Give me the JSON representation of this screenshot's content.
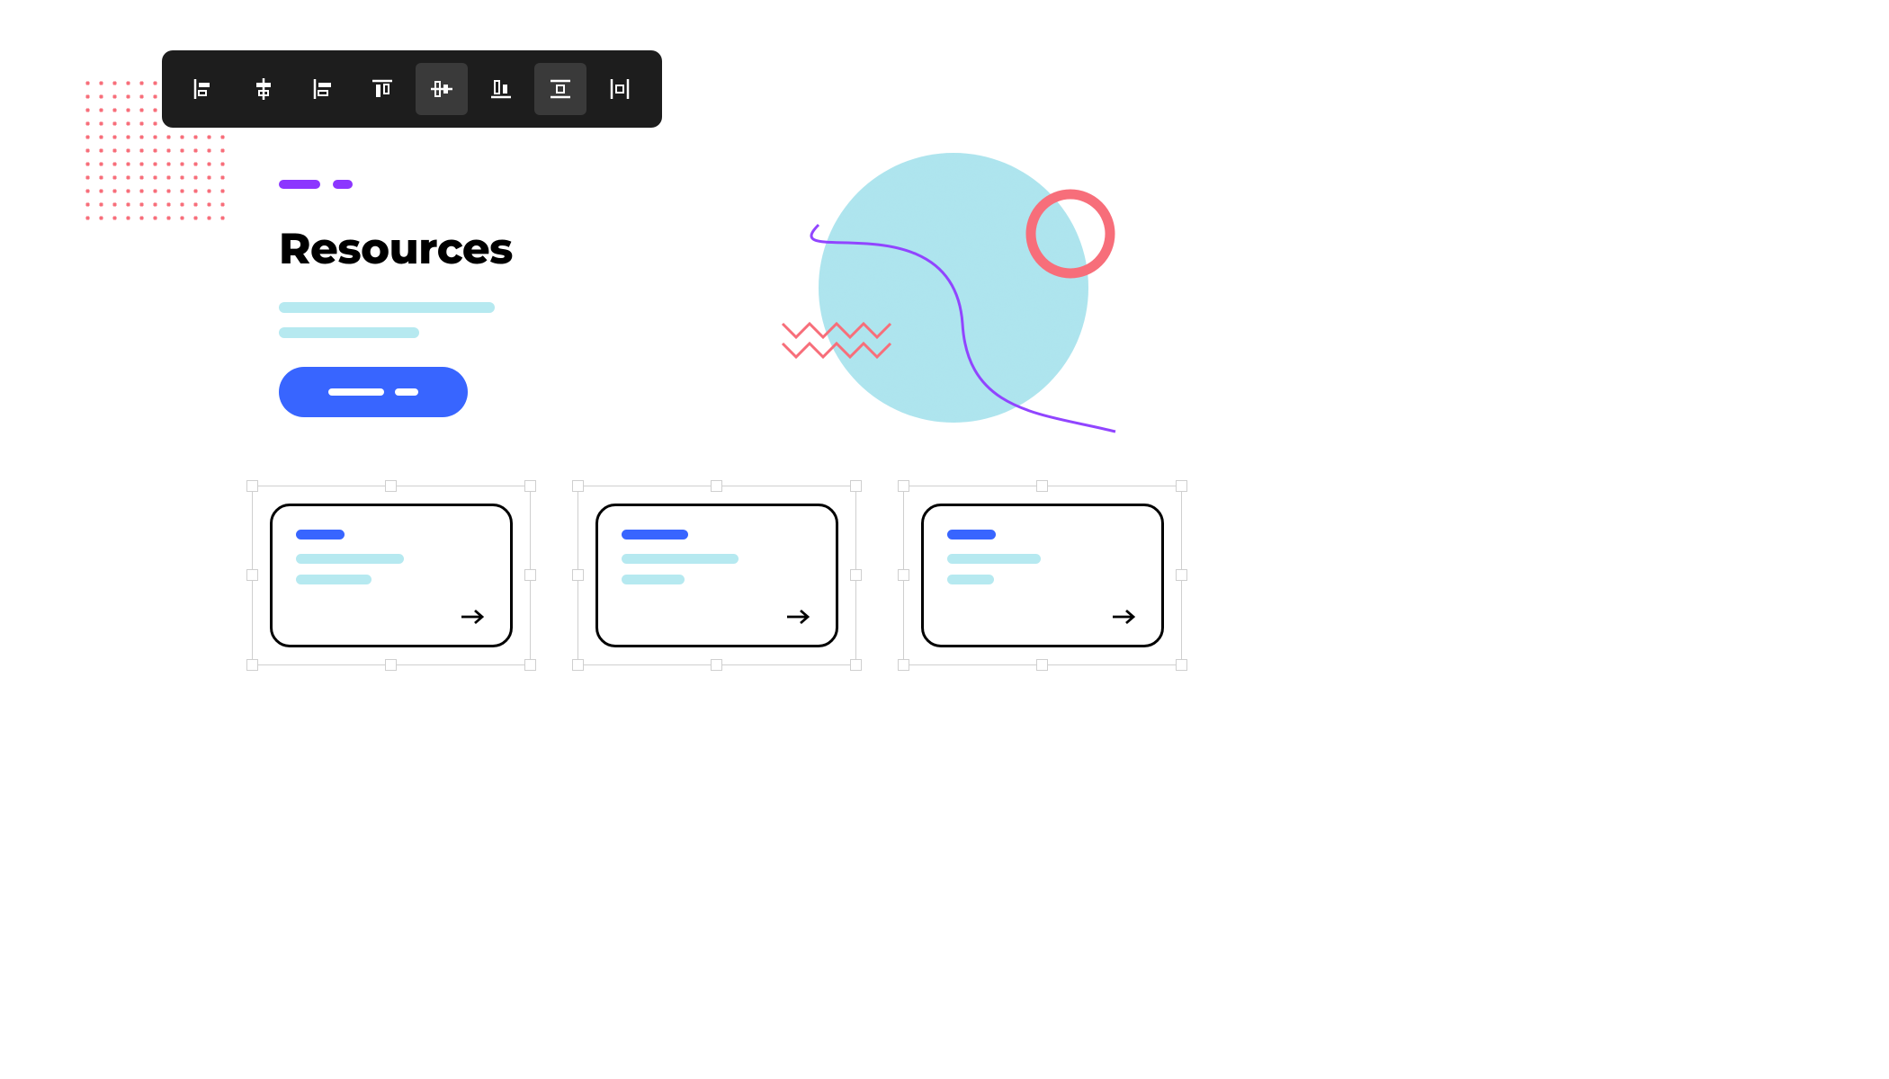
{
  "toolbar": {
    "buttons": [
      {
        "name": "align-left",
        "active": false
      },
      {
        "name": "align-center-h",
        "active": false
      },
      {
        "name": "align-right",
        "active": false
      },
      {
        "name": "align-top",
        "active": false
      },
      {
        "name": "align-middle-v",
        "active": true
      },
      {
        "name": "align-bottom",
        "active": false
      },
      {
        "name": "distribute-vertical",
        "active": true
      },
      {
        "name": "distribute-horizontal",
        "active": false
      }
    ]
  },
  "hero": {
    "title": "Resources",
    "accent_bars": [
      46,
      22
    ],
    "subtitle_line_widths": [
      240,
      156
    ],
    "cta_segments": [
      62,
      26
    ]
  },
  "cards": [
    {
      "tag_width": 54,
      "line_widths": [
        120,
        84
      ]
    },
    {
      "tag_width": 74,
      "line_widths": [
        130,
        70
      ]
    },
    {
      "tag_width": 54,
      "line_widths": [
        104,
        52
      ]
    }
  ],
  "colors": {
    "toolbar_bg": "#1d1d1d",
    "accent_purple": "#8c36ff",
    "cta_blue": "#3865ff",
    "placeholder_teal": "#b6e9f0",
    "decorative_pink": "#f76e7a",
    "decorative_circle": "#a6e2ec"
  }
}
